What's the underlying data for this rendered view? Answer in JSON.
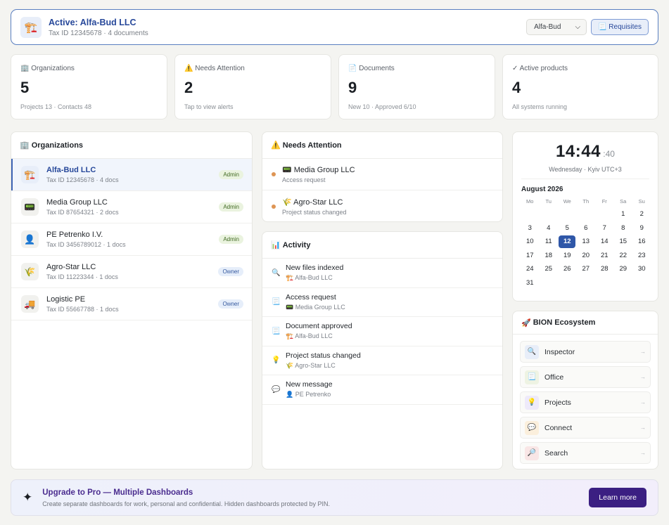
{
  "active": {
    "icon": "🏗️",
    "title": "Active: Alfa-Bud LLC",
    "subtitle": "Tax ID 12345678 · 4 documents",
    "select_value": "Alfa-Bud",
    "requisites_label": "📃 Requisites"
  },
  "stats": [
    {
      "label": "🏢 Organizations",
      "value": "5",
      "foot": "Projects 13 · Contacts 48"
    },
    {
      "label": "⚠️ Needs Attention",
      "value": "2",
      "foot": "Tap to view alerts"
    },
    {
      "label": "📄 Documents",
      "value": "9",
      "foot": "New 10 · Approved 6/10"
    },
    {
      "label": "✓ Active products",
      "value": "4",
      "foot": "All systems running"
    }
  ],
  "organizations": {
    "title": "Organizations",
    "icon": "🏢",
    "items": [
      {
        "icon": "🏗️",
        "name": "Alfa-Bud LLC",
        "meta": "Tax ID 12345678 · 4 docs",
        "role": "Admin"
      },
      {
        "icon": "📟",
        "name": "Media Group LLC",
        "meta": "Tax ID 87654321 · 2 docs",
        "role": "Admin"
      },
      {
        "icon": "👤",
        "name": "PE Petrenko I.V.",
        "meta": "Tax ID 3456789012 · 1 docs",
        "role": "Admin"
      },
      {
        "icon": "🌾",
        "name": "Agro-Star LLC",
        "meta": "Tax ID 11223344 · 1 docs",
        "role": "Owner"
      },
      {
        "icon": "🚚",
        "name": "Logistic PE",
        "meta": "Tax ID 55667788 · 1 docs",
        "role": "Owner"
      }
    ]
  },
  "attention": {
    "title": "Needs Attention",
    "icon": "⚠️",
    "items": [
      {
        "name": "📟 Media Group LLC",
        "meta": "Access request"
      },
      {
        "name": "🌾 Agro-Star LLC",
        "meta": "Project status changed"
      }
    ]
  },
  "activity": {
    "title": "Activity",
    "icon": "📊",
    "items": [
      {
        "icon": "🔍",
        "name": "New files indexed",
        "meta": "🏗️ Alfa-Bud LLC"
      },
      {
        "icon": "📃",
        "name": "Access request",
        "meta": "📟 Media Group LLC"
      },
      {
        "icon": "📃",
        "name": "Document approved",
        "meta": "🏗️ Alfa-Bud LLC"
      },
      {
        "icon": "💡",
        "name": "Project status changed",
        "meta": "🌾 Agro-Star LLC"
      },
      {
        "icon": "💬",
        "name": "New message",
        "meta": "👤 PE Petrenko"
      }
    ]
  },
  "clock": {
    "time": "14:44",
    "seconds": ":40",
    "date": "Wednesday · Kyiv UTC+3"
  },
  "calendar": {
    "month": "August 2026",
    "weekdays": [
      "Mo",
      "Tu",
      "We",
      "Th",
      "Fr",
      "Sa",
      "Su"
    ],
    "leading_blanks": 5,
    "days": 31,
    "today": 12
  },
  "ecosystem": {
    "title": "BION Ecosystem",
    "icon": "🚀",
    "items": [
      {
        "icon": "🔍",
        "name": "Inspector",
        "bg": "#e8eef9"
      },
      {
        "icon": "📃",
        "name": "Office",
        "bg": "#eef3e3"
      },
      {
        "icon": "💡",
        "name": "Projects",
        "bg": "#eeeafa"
      },
      {
        "icon": "💬",
        "name": "Connect",
        "bg": "#fbefdc"
      },
      {
        "icon": "🔎",
        "name": "Search",
        "bg": "#f9e6e6"
      }
    ],
    "arrow": "→"
  },
  "upgrade": {
    "icon": "✦",
    "title": "Upgrade to Pro — Multiple Dashboards",
    "subtitle": "Create separate dashboards for work, personal and confidential. Hidden dashboards protected by PIN.",
    "button": "Learn more"
  }
}
